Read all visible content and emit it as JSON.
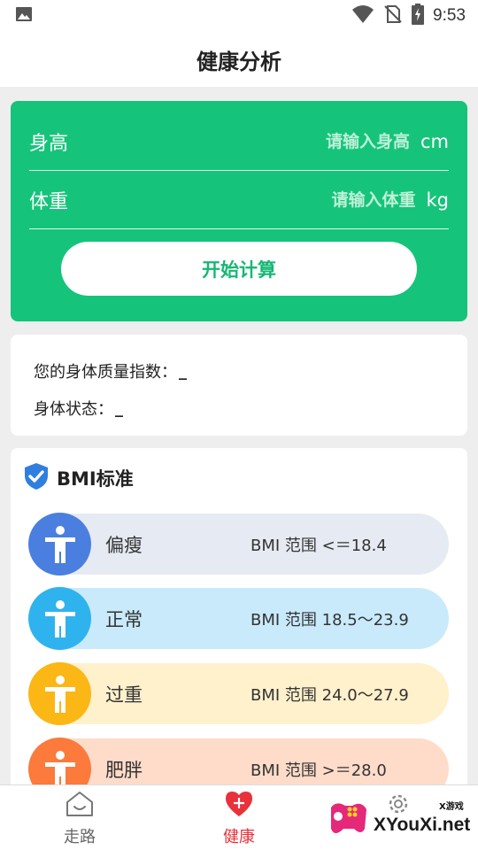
{
  "status_bar": {
    "time": "9:53"
  },
  "app_bar": {
    "title": "健康分析"
  },
  "calculator": {
    "height": {
      "label": "身高",
      "placeholder": "请输入身高",
      "unit": "cm"
    },
    "weight": {
      "label": "体重",
      "placeholder": "请输入体重",
      "unit": "kg"
    },
    "start_button": "开始计算",
    "bg_color": "#15c47a"
  },
  "result": {
    "bmi_label": "您的身体质量指数：",
    "bmi_value": "_",
    "state_label": "身体状态：",
    "state_value": "_"
  },
  "bmi_standard": {
    "title": "BMI标准",
    "levels": [
      {
        "name": "偏瘦",
        "range": "BMI 范围 <＝18.4",
        "circle_color": "#4a7fe0",
        "bg_color": "#e6ebf3"
      },
      {
        "name": "正常",
        "range": "BMI 范围 18.5～23.9",
        "circle_color": "#2fb3ee",
        "bg_color": "#c9eafb"
      },
      {
        "name": "过重",
        "range": "BMI 范围 24.0～27.9",
        "circle_color": "#fbb715",
        "bg_color": "#fff1cc"
      },
      {
        "name": "肥胖",
        "range": "BMI 范围 >＝28.0",
        "circle_color": "#fb7a3c",
        "bg_color": "#ffdcc9"
      }
    ]
  },
  "bottom_nav": {
    "items": [
      {
        "label": "走路",
        "icon": "house-face-icon",
        "active": false
      },
      {
        "label": "健康",
        "icon": "heart-plus-icon",
        "active": true
      },
      {
        "label": "",
        "icon": "gear-icon",
        "active": false
      }
    ],
    "active_color": "#e8313b",
    "inactive_color": "#666666"
  },
  "watermark": {
    "brand": "XYouXi.net",
    "small": "X游戏"
  }
}
